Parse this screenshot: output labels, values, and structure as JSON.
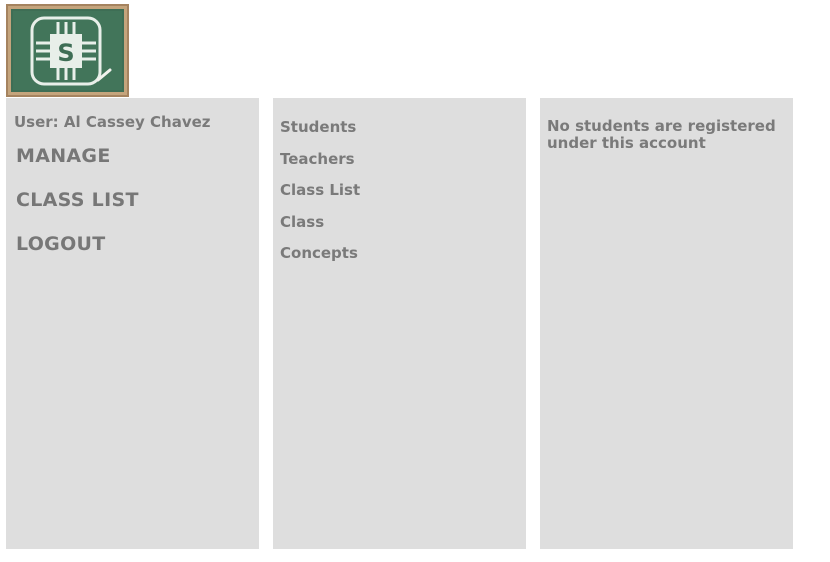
{
  "logo": {
    "icon": "chalkboard-chip-logo",
    "letter": "S",
    "frame_color": "#a5835f",
    "board_color": "#3e6e55"
  },
  "left_panel": {
    "user_label": "User: Al Cassey Chavez",
    "nav": [
      {
        "label": "MANAGE"
      },
      {
        "label": "CLASS LIST"
      },
      {
        "label": "LOGOUT"
      }
    ]
  },
  "middle_panel": {
    "nav": [
      {
        "label": "Students"
      },
      {
        "label": "Teachers"
      },
      {
        "label": "Class List"
      },
      {
        "label": "Class"
      },
      {
        "label": "Concepts"
      }
    ]
  },
  "right_panel": {
    "message": "No students are registered under this account"
  },
  "colors": {
    "panel_background": "#dedede",
    "text": "#7a7a7a"
  }
}
